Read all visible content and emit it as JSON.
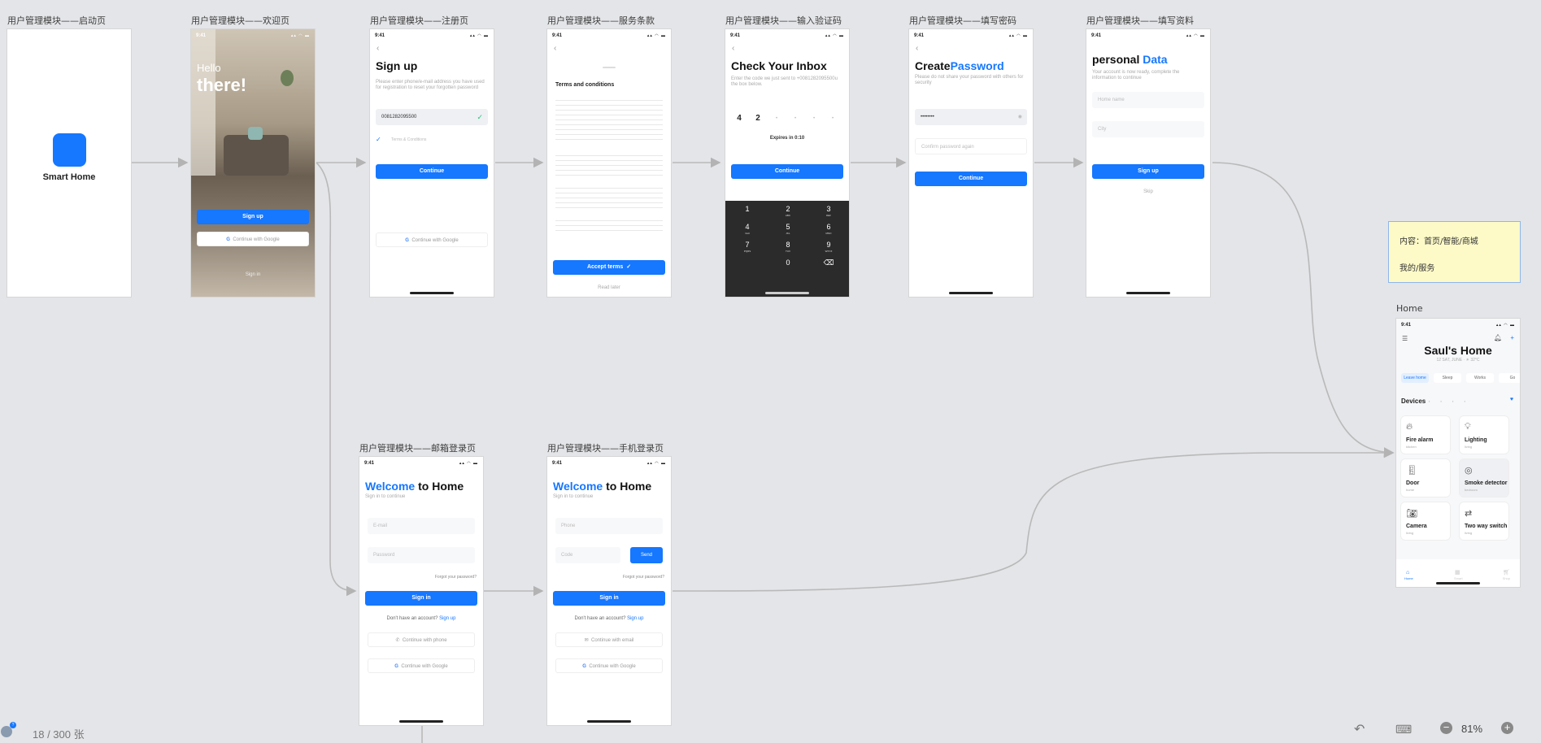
{
  "frames": {
    "splash": {
      "title": "用户管理模块——启动页",
      "logo_text": "Smart Home"
    },
    "welcome": {
      "title": "用户管理模块——欢迎页",
      "hello": "Hello",
      "there": "there!",
      "signup": "Sign up",
      "google": "Continue with Google",
      "signin": "Sign in",
      "time": "9:41"
    },
    "signup": {
      "title": "用户管理模块——注册页",
      "time": "9:41",
      "heading": "Sign up",
      "desc": "Please enter phone/e-mail address you have used for registration to reset your forgotten password",
      "phone_value": "0081282095500",
      "terms": "Terms & Conditions",
      "continue": "Continue",
      "google": "Continue with Google"
    },
    "terms": {
      "title": "用户管理模块——服务条款",
      "time": "9:41",
      "heading": "Terms and conditions",
      "accept": "Accept terms",
      "read_later": "Read later"
    },
    "inbox": {
      "title": "用户管理模块——输入验证码",
      "time": "9:41",
      "heading": "Check Your Inbox",
      "desc": "Enter the code we just sent to +0081282095500u the box below.",
      "code": [
        "4",
        "2",
        "•",
        "•",
        "•",
        "•"
      ],
      "expires": "Expires in 0:10",
      "continue": "Continue",
      "keys": [
        [
          "1",
          ""
        ],
        [
          "2",
          "ABC"
        ],
        [
          "3",
          "DEF"
        ],
        [
          "4",
          "GHI"
        ],
        [
          "5",
          "JKL"
        ],
        [
          "6",
          "MNO"
        ],
        [
          "7",
          "PQRS"
        ],
        [
          "8",
          "TUV"
        ],
        [
          "9",
          "WXYZ"
        ],
        [
          "",
          ""
        ],
        [
          "0",
          ""
        ],
        [
          "⌫",
          ""
        ]
      ]
    },
    "password": {
      "title": "用户管理模块——填写密码",
      "time": "9:41",
      "heading_a": "Create",
      "heading_b": "Password",
      "desc": "Please do not share your password with others for security",
      "pw_value": "••••••••",
      "confirm_placeholder": "Confirm password again",
      "continue": "Continue"
    },
    "profile": {
      "title": "用户管理模块——填写资料",
      "time": "9:41",
      "heading_a": "personal ",
      "heading_b": "Data",
      "desc": "Your account is now ready, complete the information to continue",
      "field1": "Home name",
      "field2": "City",
      "signup": "Sign up",
      "skip": "Skip"
    },
    "email_login": {
      "title": "用户管理模块——邮箱登录页",
      "time": "9:41",
      "heading_a": "Welcome",
      "heading_b": " to Home",
      "sub": "Sign in to continue",
      "email_placeholder": "E-mail",
      "password_placeholder": "Password",
      "forgot": "Forgot your password?",
      "signin": "Sign in",
      "no_account": "Don't have an account? ",
      "signup_link": "Sign up",
      "alt1": "Continue with phone",
      "alt2": "Continue with Google"
    },
    "phone_login": {
      "title": "用户管理模块——手机登录页",
      "time": "9:41",
      "heading_a": "Welcome",
      "heading_b": " to Home",
      "sub": "Sign in to continue",
      "phone_placeholder": "Phone",
      "code_placeholder": "Code",
      "send": "Send",
      "forgot": "Forgot your password?",
      "signin": "Sign in",
      "no_account": "Don't have an account? ",
      "signup_link": "Sign up",
      "alt1": "Continue with email",
      "alt2": "Continue with Google"
    },
    "home": {
      "title": "Home",
      "time": "9:41",
      "heading": "Saul's Home",
      "date": "12 SAT, JUNE · ☀ 32°C",
      "chips": [
        "Leave home",
        "Sleep",
        "Works",
        "Go"
      ],
      "devices_label": "Devices",
      "tiles": [
        {
          "name": "Fire alarm",
          "sub": "kitchen"
        },
        {
          "name": "Lighting",
          "sub": "living"
        },
        {
          "name": "Door",
          "sub": "home"
        },
        {
          "name": "Smoke detector",
          "sub": "bedroom"
        },
        {
          "name": "Camera",
          "sub": "living"
        },
        {
          "name": "Two way switch",
          "sub": "living"
        }
      ],
      "tabs": [
        "Home",
        "Smart",
        "Shop"
      ]
    }
  },
  "note": {
    "line1": "内容：首页/智能/商城",
    "line2": "我的/服务"
  },
  "footer": {
    "page_count": "18 / 300 张",
    "zoom": "81%"
  },
  "colors": {
    "accent": "#1677ff",
    "canvas": "#e4e5e8",
    "note_bg": "#fdfac8",
    "connector": "#b9b9b9"
  }
}
